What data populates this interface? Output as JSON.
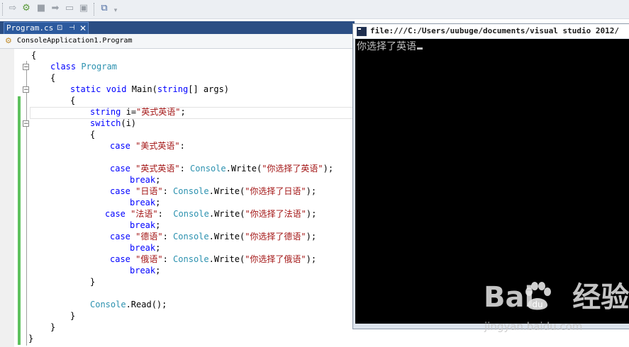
{
  "toolbar": {
    "icons": [
      "step-forward-icon",
      "attach-process-icon",
      "stop-icon",
      "step-over-icon",
      "disabled-icon",
      "toolbox-icon",
      "overflow-chevron-icon"
    ]
  },
  "editor": {
    "tab_label": "Program.cs",
    "tab_lock_glyph": "🔒",
    "tab_pin_glyph": "⊣",
    "tab_close_glyph": "✕",
    "nav_label": "ConsoleApplication1.Program",
    "code": {
      "l0_open": "{",
      "l1_kw": "class",
      "l1_ty": "Program",
      "l2_open": "{",
      "l3_kw1": "static",
      "l3_kw2": "void",
      "l3_name": "Main(",
      "l3_kw3": "string",
      "l3_rest": "[] args)",
      "l4_open": "{",
      "l5_kw": "string",
      "l5_rest": "i=",
      "l5_str": "\"英式英语\"",
      "l5_end": ";",
      "l6_kw": "switch",
      "l6_rest": "(i)",
      "l7_open": "{",
      "l8_kw": "case",
      "l8_str": "\"美式英语\"",
      "l8_end": ":",
      "l9_kw": "case",
      "l9_str": "\"英式英语\"",
      "l9_mid": ": ",
      "l9_ty": "Console",
      "l9_call": ".Write(",
      "l9_arg": "\"你选择了英语\"",
      "l9_end": ");",
      "l10_kw": "break",
      "l10_end": ";",
      "l11_kw": "case",
      "l11_str": "\"日语\"",
      "l11_mid": ": ",
      "l11_ty": "Console",
      "l11_call": ".Write(",
      "l11_arg": "\"你选择了日语\"",
      "l11_end": ");",
      "l12_kw": "break",
      "l12_end": ";",
      "l13_kw": "case",
      "l13_str": "\"法语\"",
      "l13_mid": ":  ",
      "l13_ty": "Console",
      "l13_call": ".Write(",
      "l13_arg": "\"你选择了法语\"",
      "l13_end": ");",
      "l14_kw": "break",
      "l14_end": ";",
      "l15_kw": "case",
      "l15_str": "\"德语\"",
      "l15_mid": ": ",
      "l15_ty": "Console",
      "l15_call": ".Write(",
      "l15_arg": "\"你选择了德语\"",
      "l15_end": ");",
      "l16_kw": "break",
      "l16_end": ";",
      "l17_kw": "case",
      "l17_str": "\"俄语\"",
      "l17_mid": ": ",
      "l17_ty": "Console",
      "l17_call": ".Write(",
      "l17_arg": "\"你选择了俄语\"",
      "l17_end": ");",
      "l18_kw": "break",
      "l18_end": ";",
      "l19_close": "}",
      "l21_ty": "Console",
      "l21_rest": ".Read();",
      "l22_close": "}",
      "l23_close": "}",
      "l24_close": "}"
    }
  },
  "console": {
    "title": "file:///C:/Users/uubuge/documents/visual studio 2012/",
    "output": "你选择了英语"
  },
  "watermark": {
    "logo": "Bai  经验",
    "url": "jingyan.baidu.com"
  }
}
